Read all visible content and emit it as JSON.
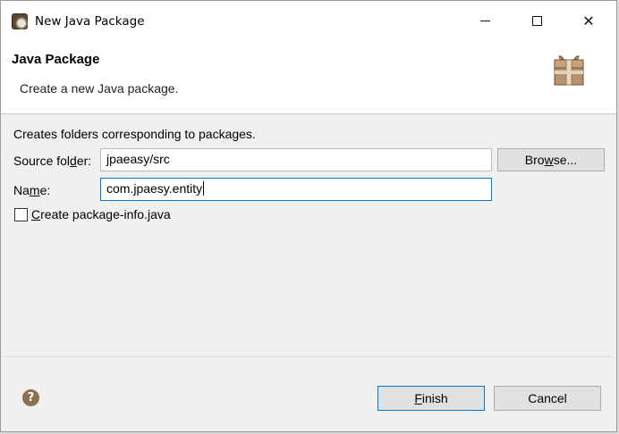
{
  "window": {
    "title": "New Java Package",
    "min_glyph": "—",
    "close_glyph": "✕"
  },
  "banner": {
    "title": "Java Package",
    "description": "Create a new Java package."
  },
  "form": {
    "info": "Creates folders corresponding to packages.",
    "source_label_pre": "Source fol",
    "source_label_mn": "d",
    "source_label_post": "er:",
    "source_value": "jpaeasy/src",
    "browse_pre": "Bro",
    "browse_mn": "w",
    "browse_post": "se...",
    "name_label_pre": "Na",
    "name_label_mn": "m",
    "name_label_post": "e:",
    "name_value": "com.jpaesy.entity",
    "checkbox_mn": "C",
    "checkbox_post": "reate package-info.java",
    "checkbox_checked": false
  },
  "footer": {
    "help_glyph": "?",
    "finish_mn": "F",
    "finish_post": "inish",
    "cancel_label": "Cancel"
  },
  "icons": {
    "app": "eclipse-app-icon",
    "package": "package-box-icon",
    "help": "help-icon"
  },
  "colors": {
    "focus": "#0078d7",
    "dialog_bg": "#f0f0f0",
    "help": "#8f6f52"
  }
}
